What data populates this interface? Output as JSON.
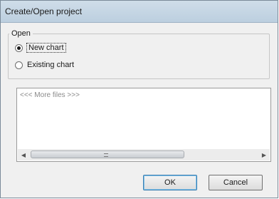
{
  "window": {
    "title": "Create/Open project"
  },
  "open_group": {
    "legend": "Open",
    "options": [
      {
        "label": "New chart",
        "selected": true
      },
      {
        "label": "Existing chart",
        "selected": false
      }
    ]
  },
  "file_list": {
    "items": [
      "<<< More files >>>"
    ]
  },
  "buttons": {
    "ok_label": "OK",
    "cancel_label": "Cancel"
  },
  "colors": {
    "titlebar": "#c4d5e4",
    "dialog_bg": "#f0f0f0",
    "ok_focus_border": "#3c7fb1"
  }
}
